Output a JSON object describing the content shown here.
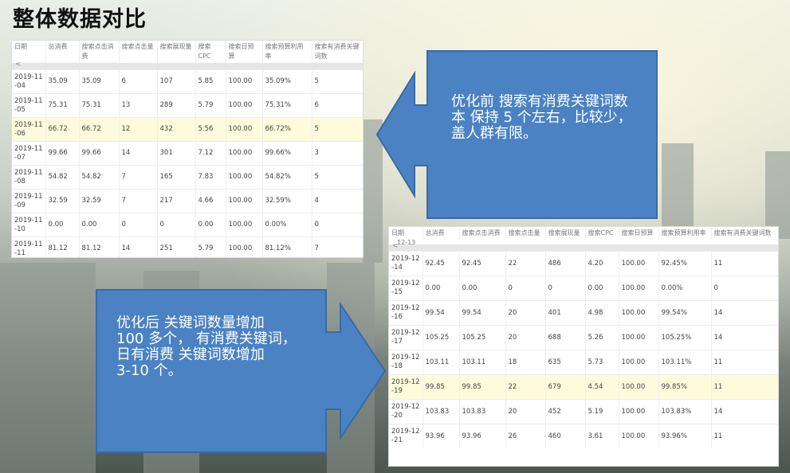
{
  "title": "整体数据对比",
  "headers": [
    "日期",
    "总消费",
    "搜索点击消费",
    "搜索点击量",
    "搜索展现量",
    "搜索CPC",
    "搜索日预算",
    "搜索预算利用率",
    "搜索有消费关键词数"
  ],
  "before": {
    "partial_top": "",
    "rows": [
      {
        "date": "2019-11-04",
        "cells": [
          "35.09",
          "35.09",
          "6",
          "107",
          "5.85",
          "100.00",
          "35.09%",
          "5"
        ]
      },
      {
        "date": "2019-11-05",
        "cells": [
          "75.31",
          "75.31",
          "13",
          "289",
          "5.79",
          "100.00",
          "75.31%",
          "6"
        ]
      },
      {
        "date": "2019-11-06",
        "cells": [
          "66.72",
          "66.72",
          "12",
          "432",
          "5.56",
          "100.00",
          "66.72%",
          "5"
        ]
      },
      {
        "date": "2019-11-07",
        "cells": [
          "99.66",
          "99.66",
          "14",
          "301",
          "7.12",
          "100.00",
          "99.66%",
          "3"
        ]
      },
      {
        "date": "2019-11-08",
        "cells": [
          "54.82",
          "54.82",
          "7",
          "165",
          "7.83",
          "100.00",
          "54.82%",
          "5"
        ]
      },
      {
        "date": "2019-11-09",
        "cells": [
          "32.59",
          "32.59",
          "7",
          "217",
          "4.66",
          "100.00",
          "32.59%",
          "4"
        ]
      },
      {
        "date": "2019-11-10",
        "cells": [
          "0.00",
          "0.00",
          "0",
          "0",
          "0.00",
          "100.00",
          "0.00%",
          "0"
        ]
      },
      {
        "date": "2019-11-11",
        "cells": [
          "81.12",
          "81.12",
          "14",
          "251",
          "5.79",
          "100.00",
          "81.12%",
          "7"
        ]
      }
    ],
    "highlight_index": 2
  },
  "after": {
    "partial_top": "12-13",
    "rows": [
      {
        "date": "2019-12-14",
        "cells": [
          "92.45",
          "92.45",
          "22",
          "486",
          "4.20",
          "100.00",
          "92.45%",
          "11"
        ]
      },
      {
        "date": "2019-12-15",
        "cells": [
          "0.00",
          "0.00",
          "0",
          "0",
          "0.00",
          "100.00",
          "0.00%",
          "0"
        ]
      },
      {
        "date": "2019-12-16",
        "cells": [
          "99.54",
          "99.54",
          "20",
          "401",
          "4.98",
          "100.00",
          "99.54%",
          "14"
        ]
      },
      {
        "date": "2019-12-17",
        "cells": [
          "105.25",
          "105.25",
          "20",
          "688",
          "5.26",
          "100.00",
          "105.25%",
          "14"
        ]
      },
      {
        "date": "2019-12-18",
        "cells": [
          "103.11",
          "103.11",
          "18",
          "635",
          "5.73",
          "100.00",
          "103.11%",
          "11"
        ]
      },
      {
        "date": "2019-12-19",
        "cells": [
          "99.85",
          "99.85",
          "22",
          "679",
          "4.54",
          "100.00",
          "99.85%",
          "11"
        ]
      },
      {
        "date": "2019-12-20",
        "cells": [
          "103.83",
          "103.83",
          "20",
          "452",
          "5.19",
          "100.00",
          "103.83%",
          "14"
        ]
      },
      {
        "date": "2019-12-21",
        "cells": [
          "93.96",
          "93.96",
          "26",
          "460",
          "3.61",
          "100.00",
          "93.96%",
          "11"
        ]
      }
    ],
    "highlight_index": 5
  },
  "scroll_glyph": "<",
  "callout_before": "优化前 搜索有消费关键词数\n本 保持 5 个左右，比较少，\n盖人群有限。",
  "callout_after": "优化后 关键词数量增加\n100  多个，  有消费关键词，\n日有消费 关键词数增加\n3-10 个。",
  "colors": {
    "callout": "#4a82c3",
    "callout_border": "#3a6aa3",
    "highlight": "#fdfbdc"
  }
}
